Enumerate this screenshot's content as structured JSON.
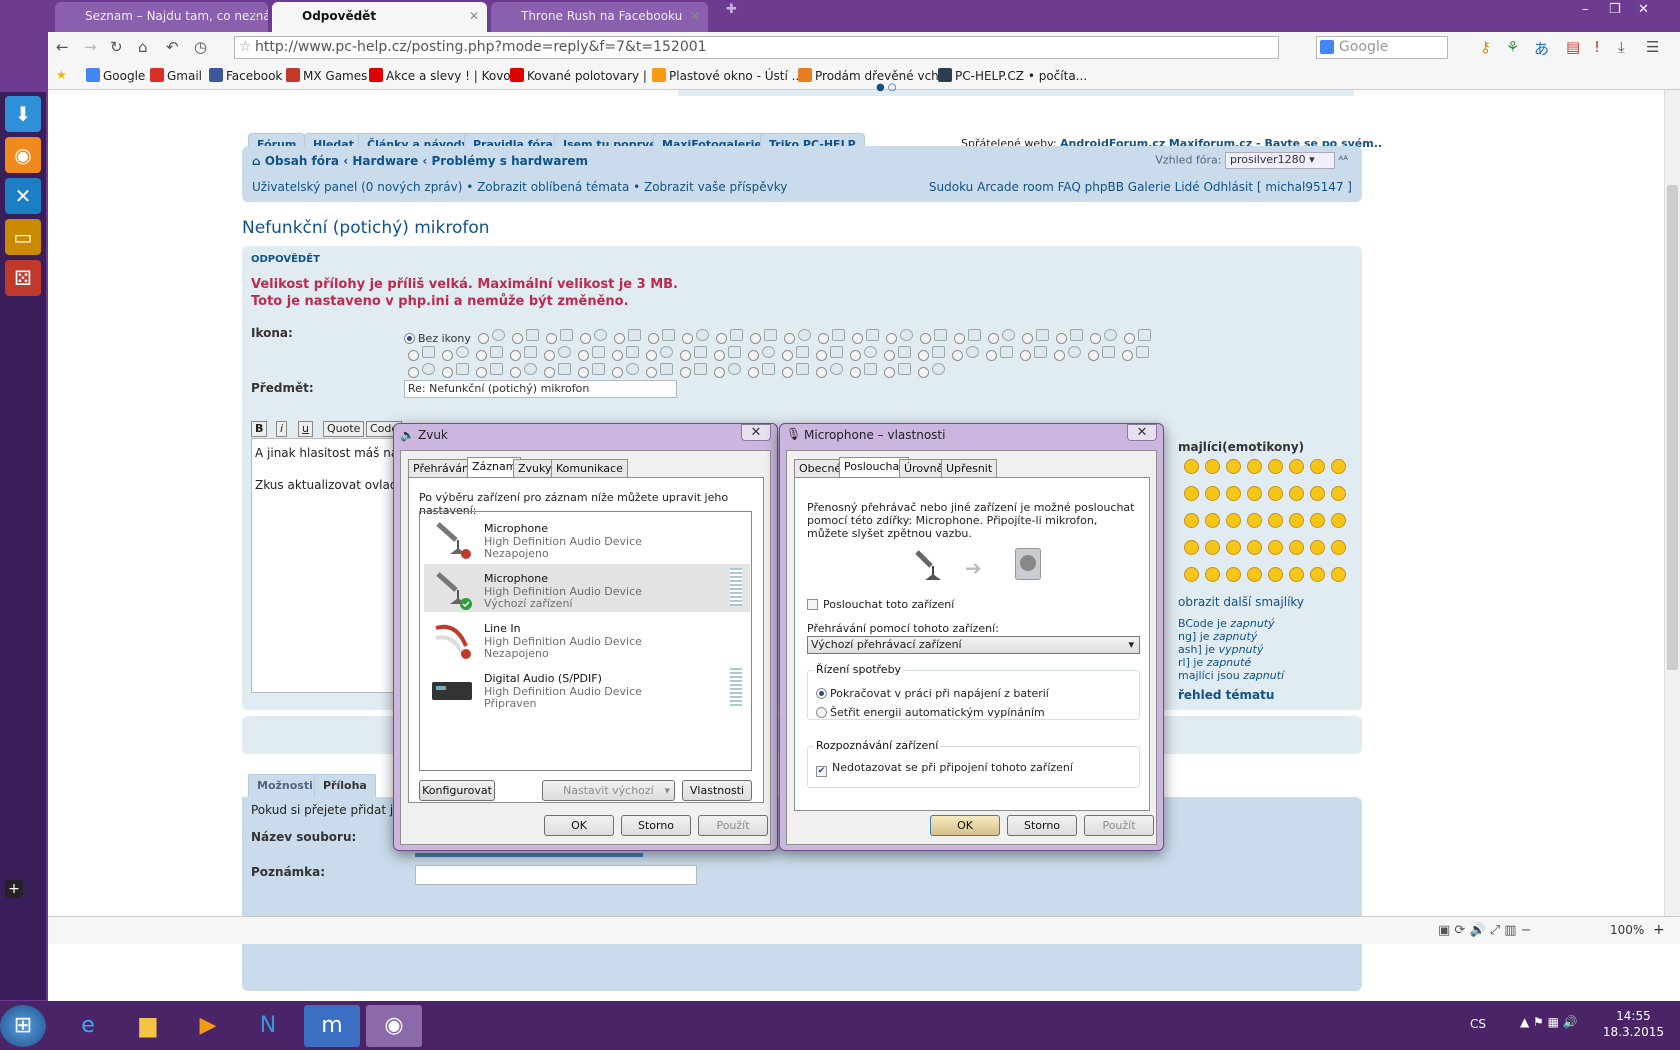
{
  "tabs": [
    {
      "title": "Seznam – Najdu tam, co neznám",
      "active": false
    },
    {
      "title": "Odpovědět",
      "active": true
    },
    {
      "title": "Throne Rush na Facebooku",
      "active": false
    }
  ],
  "toolbar": {
    "url": "http://www.pc-help.cz/posting.php?mode=reply&f=7&t=152001",
    "search_placeholder": "Google"
  },
  "bookmarks": [
    {
      "label": "Google",
      "color": "#4285f4"
    },
    {
      "label": "Gmail",
      "color": "#d93025"
    },
    {
      "label": "Facebook",
      "color": "#3b5998"
    },
    {
      "label": "MX Games",
      "color": "#c0392b"
    },
    {
      "label": "Akce a slevy ! | Kovo...",
      "color": "#d00"
    },
    {
      "label": "Kované polotovary | ...",
      "color": "#d00"
    },
    {
      "label": "Plastové okno - Ústí ...",
      "color": "#f39c12"
    },
    {
      "label": "Prodám dřevěné vch...",
      "color": "#e67e22"
    },
    {
      "label": "PC-HELP.CZ • počíta...",
      "color": "#2c3e50"
    }
  ],
  "forum": {
    "navtabs": [
      "Fórum",
      "Hledat",
      "Články a návody",
      "Pravidla fóra",
      "Jsem tu poprvé",
      "MaxiFotogalerie",
      "Triko PC-HELP"
    ],
    "friendly_label": "Spřátelené weby:",
    "friendly_1": "AndroidForum.cz",
    "friendly_2": "Maxiforum.cz - Bavte se po svém..",
    "breadcrumb": "Obsah fóra ‹ Hardware ‹ Problémy s hardwarem",
    "style_label": "Vzhled fóra:",
    "style_value": "prosilver1280",
    "ucp_left": "Uživatelský panel (0 nových zpráv) • Zobrazit oblíbená témata • Zobrazit vaše příspěvky",
    "ucp_right": "Sudoku   Arcade room   FAQ phpBB   Galerie   Lidé   Odhlásit [ michal95147 ]",
    "topic_title": "Nefunkční (potichý) mikrofon",
    "reply_heading": "ODPOVĚDĚT",
    "error_1": "Velikost přílohy je příliš velká. Maximální velikost je 3 MB.",
    "error_2": "Toto je nastaveno v php.ini a nemůže být změněno.",
    "icon_label": "Ikona:",
    "no_icon": "Bez ikony",
    "subject_label": "Předmět:",
    "subject_value": "Re: Nefunkční (potichý) mikrofon",
    "bbcode": [
      "B",
      "i",
      "u",
      "Quote",
      "Code"
    ],
    "message_line_1": "A jinak hlasitost máš nas",
    "message_line_2": "Zkus aktualizovat ovladač",
    "smileys_title": "majlíci(emotikony)",
    "smileys_more": "obrazit další smajlíky",
    "bbcode_info": [
      {
        "k": "BCode",
        "v": "je",
        "s": "zapnutý"
      },
      {
        "k": "ng]",
        "v": "je",
        "s": "zapnutý"
      },
      {
        "k": "ash]",
        "v": "je",
        "s": "vypnutý"
      },
      {
        "k": "rl]",
        "v": "je",
        "s": "zapnuté"
      },
      {
        "k": "majlíci",
        "v": "jsou",
        "s": "zapnutí"
      }
    ],
    "topic_review": "řehled tématu",
    "options_tab": "Možnosti",
    "attach_tab": "Příloha",
    "attach_hint": "Pokud si přejete přidat j",
    "filename_label": "Název souboru:",
    "note_label": "Poznámka:"
  },
  "sound_dialog": {
    "title": "Zvuk",
    "tabs": [
      "Přehrávání",
      "Záznam",
      "Zvuky",
      "Komunikace"
    ],
    "active_tab": "Záznam",
    "instruction": "Po výběru zařízení pro záznam níže můžete upravit jeho nastavení:",
    "devices": [
      {
        "name": "Microphone",
        "driver": "High Definition Audio Device",
        "status": "Nezapojeno"
      },
      {
        "name": "Microphone",
        "driver": "High Definition Audio Device",
        "status": "Výchozí zařízení"
      },
      {
        "name": "Line In",
        "driver": "High Definition Audio Device",
        "status": "Nezapojeno"
      },
      {
        "name": "Digital Audio (S/PDIF)",
        "driver": "High Definition Audio Device",
        "status": "Připraven"
      }
    ],
    "configure": "Konfigurovat",
    "set_default": "Nastavit výchozí",
    "properties": "Vlastnosti",
    "ok": "OK",
    "cancel": "Storno",
    "apply": "Použít"
  },
  "mic_dialog": {
    "title": "Microphone – vlastnosti",
    "tabs": [
      "Obecné",
      "Poslouchat",
      "Úrovně",
      "Upřesnit"
    ],
    "active_tab": "Poslouchat",
    "description": "Přenosný přehrávač nebo jiné zařízení je možné poslouchat pomocí této zdířky: Microphone. Připojíte-li mikrofon, můžete slyšet zpětnou vazbu.",
    "listen_checkbox": "Poslouchat toto zařízení",
    "playback_label": "Přehrávání pomocí tohoto zařízení:",
    "playback_value": "Výchozí přehrávací zařízení",
    "power_group": "Řízení spotřeby",
    "power_opt_1": "Pokračovat v práci při napájení z baterií",
    "power_opt_2": "Šetřit energii automatickým vypínáním",
    "detect_group": "Rozpoznávání zařízení",
    "detect_checkbox": "Nedotazovat se při připojení tohoto zařízení",
    "ok": "OK",
    "cancel": "Storno",
    "apply": "Použít"
  },
  "statusbar": {
    "zoom": "100%"
  },
  "taskbar": {
    "lang": "CS",
    "time": "14:55",
    "date": "18.3.2015"
  }
}
